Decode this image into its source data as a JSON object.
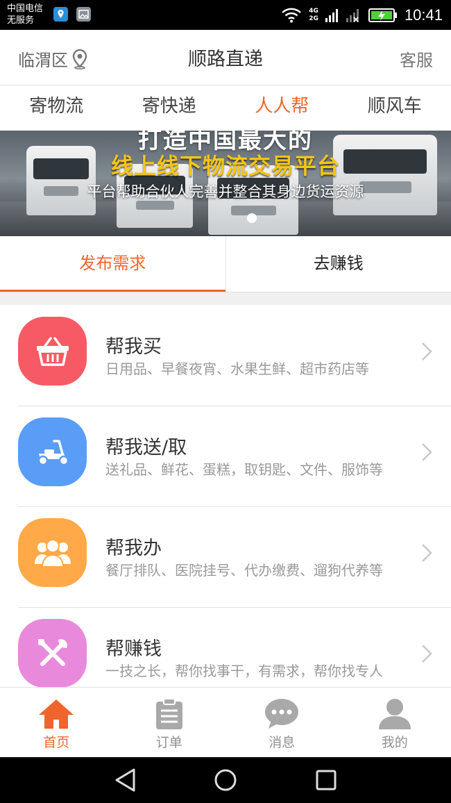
{
  "status_bar": {
    "carrier_line1": "中国电信",
    "carrier_line2": "无服务",
    "net_top": "4G",
    "net_bottom": "2G",
    "time": "10:41"
  },
  "header": {
    "location": "临渭区",
    "title": "顺路直递",
    "service": "客服"
  },
  "category_tabs": [
    {
      "label": "寄物流",
      "active": false
    },
    {
      "label": "寄快递",
      "active": false
    },
    {
      "label": "人人帮",
      "active": true
    },
    {
      "label": "顺风车",
      "active": false
    }
  ],
  "banner": {
    "top_line": "打造中国最大的",
    "headline": "线上线下物流交易平台",
    "subtitle": "平台帮助合伙人完善并整合其身边货运资源"
  },
  "action_tabs": [
    {
      "label": "发布需求",
      "active": true
    },
    {
      "label": "去赚钱",
      "active": false
    }
  ],
  "services": [
    {
      "title": "帮我买",
      "desc": "日用品、早餐夜宵、水果生鲜、超市药店等",
      "icon": "shopping-basket-icon",
      "color": "#f75a64"
    },
    {
      "title": "帮我送/取",
      "desc": "送礼品、鲜花、蛋糕，取钥匙、文件、服饰等",
      "icon": "scooter-icon",
      "color": "#5a9df7"
    },
    {
      "title": "帮我办",
      "desc": "餐厅排队、医院挂号、代办缴费、遛狗代养等",
      "icon": "people-group-icon",
      "color": "#ffa948"
    },
    {
      "title": "帮赚钱",
      "desc": "一技之长，帮你找事干，有需求，帮你找专人",
      "icon": "tools-icon",
      "color": "#e889dc"
    }
  ],
  "bottom_nav": [
    {
      "label": "首页",
      "icon": "home-icon",
      "active": true
    },
    {
      "label": "订单",
      "icon": "clipboard-icon",
      "active": false
    },
    {
      "label": "消息",
      "icon": "chat-bubble-icon",
      "active": false
    },
    {
      "label": "我的",
      "icon": "user-icon",
      "active": false
    }
  ],
  "colors": {
    "accent": "#f0652c",
    "inactive": "#8f8f8f"
  }
}
